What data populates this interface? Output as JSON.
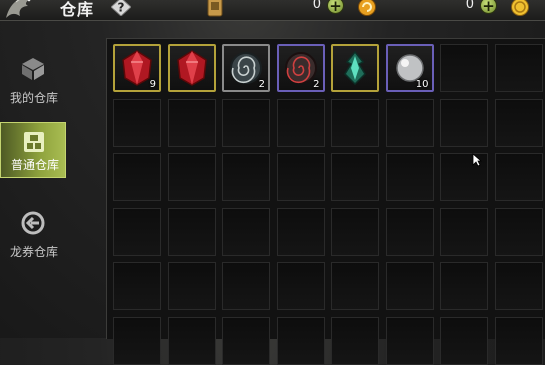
{
  "header": {
    "title": "仓库",
    "help_icon": "question-mark-icon",
    "currencies": [
      {
        "icon": "ticket-card-icon",
        "value": "0",
        "action": "plus-icon"
      },
      {
        "icon": "gold-coin-icon",
        "value": "0",
        "action": "plus-icon"
      }
    ],
    "right_icon": "gold-medal-icon"
  },
  "sidebar": {
    "tabs": [
      {
        "label": "我的仓库",
        "icon": "box-icon",
        "active": false
      },
      {
        "label": "普通仓库",
        "icon": "warehouse-icon",
        "active": true
      },
      {
        "label": "龙券仓库",
        "icon": "dragon-coupon-icon",
        "active": false
      }
    ]
  },
  "inventory": {
    "items": [
      {
        "name": "red-gem",
        "count": "9",
        "frame_color": "#b4a23a"
      },
      {
        "name": "red-gem",
        "count": "",
        "frame_color": "#b4a23a"
      },
      {
        "name": "spiral-stone",
        "count": "2",
        "frame_color": "#8a8a8a"
      },
      {
        "name": "spiral-stone-red",
        "count": "2",
        "frame_color": "#6a5fb8"
      },
      {
        "name": "green-amulet",
        "count": "",
        "frame_color": "#b4a23a"
      },
      {
        "name": "silver-pearl",
        "count": "10",
        "frame_color": "#6a5fb8"
      }
    ]
  }
}
